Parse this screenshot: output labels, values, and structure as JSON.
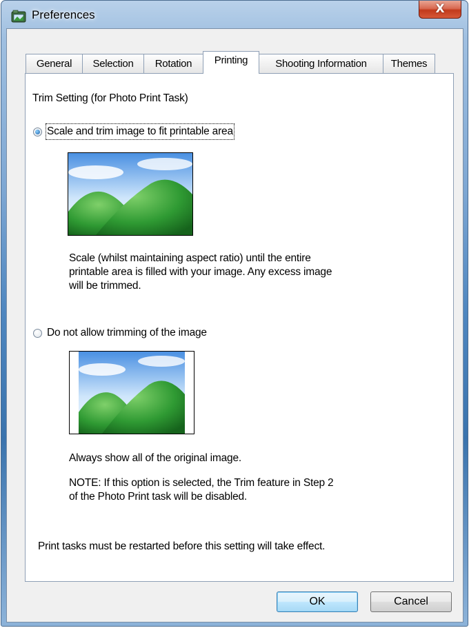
{
  "window": {
    "title": "Preferences",
    "close_glyph": "X"
  },
  "tabs": [
    {
      "label": "General"
    },
    {
      "label": "Selection"
    },
    {
      "label": "Rotation"
    },
    {
      "label": "Printing"
    },
    {
      "label": "Shooting Information"
    },
    {
      "label": "Themes"
    }
  ],
  "active_tab": "Printing",
  "printing": {
    "section_title": "Trim Setting (for Photo Print Task)",
    "option_trim": {
      "label": "Scale and trim image to fit printable area",
      "checked": true,
      "desc_lines": [
        "Scale (whilst maintaining aspect ratio) until the entire",
        "printable area is filled with your image. Any excess image",
        "will be trimmed."
      ]
    },
    "option_no_trim": {
      "label": "Do not allow trimming of the image",
      "checked": false,
      "desc": "Always show all of the original image.",
      "note_lines": [
        "NOTE: If this option is selected, the Trim feature in Step 2",
        "of the Photo Print task will be disabled."
      ]
    },
    "footer_note": "Print tasks must be restarted before this setting will take effect."
  },
  "buttons": {
    "ok": "OK",
    "cancel": "Cancel"
  },
  "icons": {
    "app": "camera-app-icon",
    "close": "close-icon"
  },
  "colors": {
    "accent": "#3c7fb1",
    "close": "#c23a1c",
    "hill": "#2e8b2e",
    "sky": "#5aa0e8"
  }
}
